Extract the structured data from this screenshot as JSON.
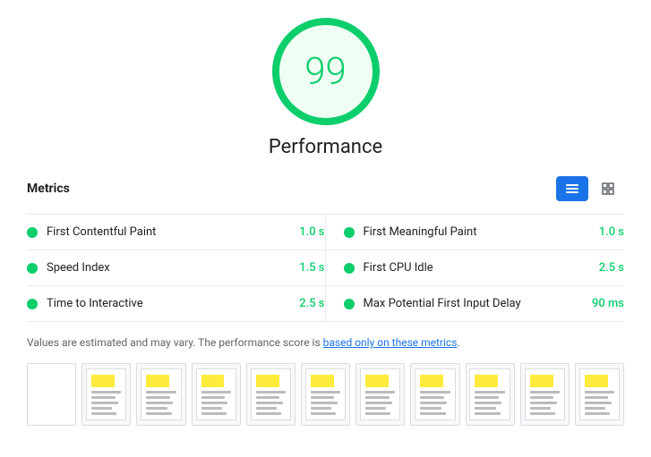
{
  "score": {
    "value": "99",
    "label": "Performance"
  },
  "metrics": {
    "title": "Metrics",
    "left": [
      {
        "name": "First Contentful Paint",
        "value": "1.0 s"
      },
      {
        "name": "Speed Index",
        "value": "1.5 s"
      },
      {
        "name": "Time to Interactive",
        "value": "2.5 s"
      }
    ],
    "right": [
      {
        "name": "First Meaningful Paint",
        "value": "1.0 s"
      },
      {
        "name": "First CPU Idle",
        "value": "2.5 s"
      },
      {
        "name": "Max Potential First Input Delay",
        "value": "90 ms"
      }
    ]
  },
  "disclaimer": {
    "text_before": "Values are estimated and may vary. The performance score is ",
    "link_text": "based only on these metrics",
    "text_after": "."
  },
  "filmstrip": {
    "frame_count": 11
  },
  "toggle": {
    "list_label": "List view",
    "grid_label": "Grid view"
  }
}
